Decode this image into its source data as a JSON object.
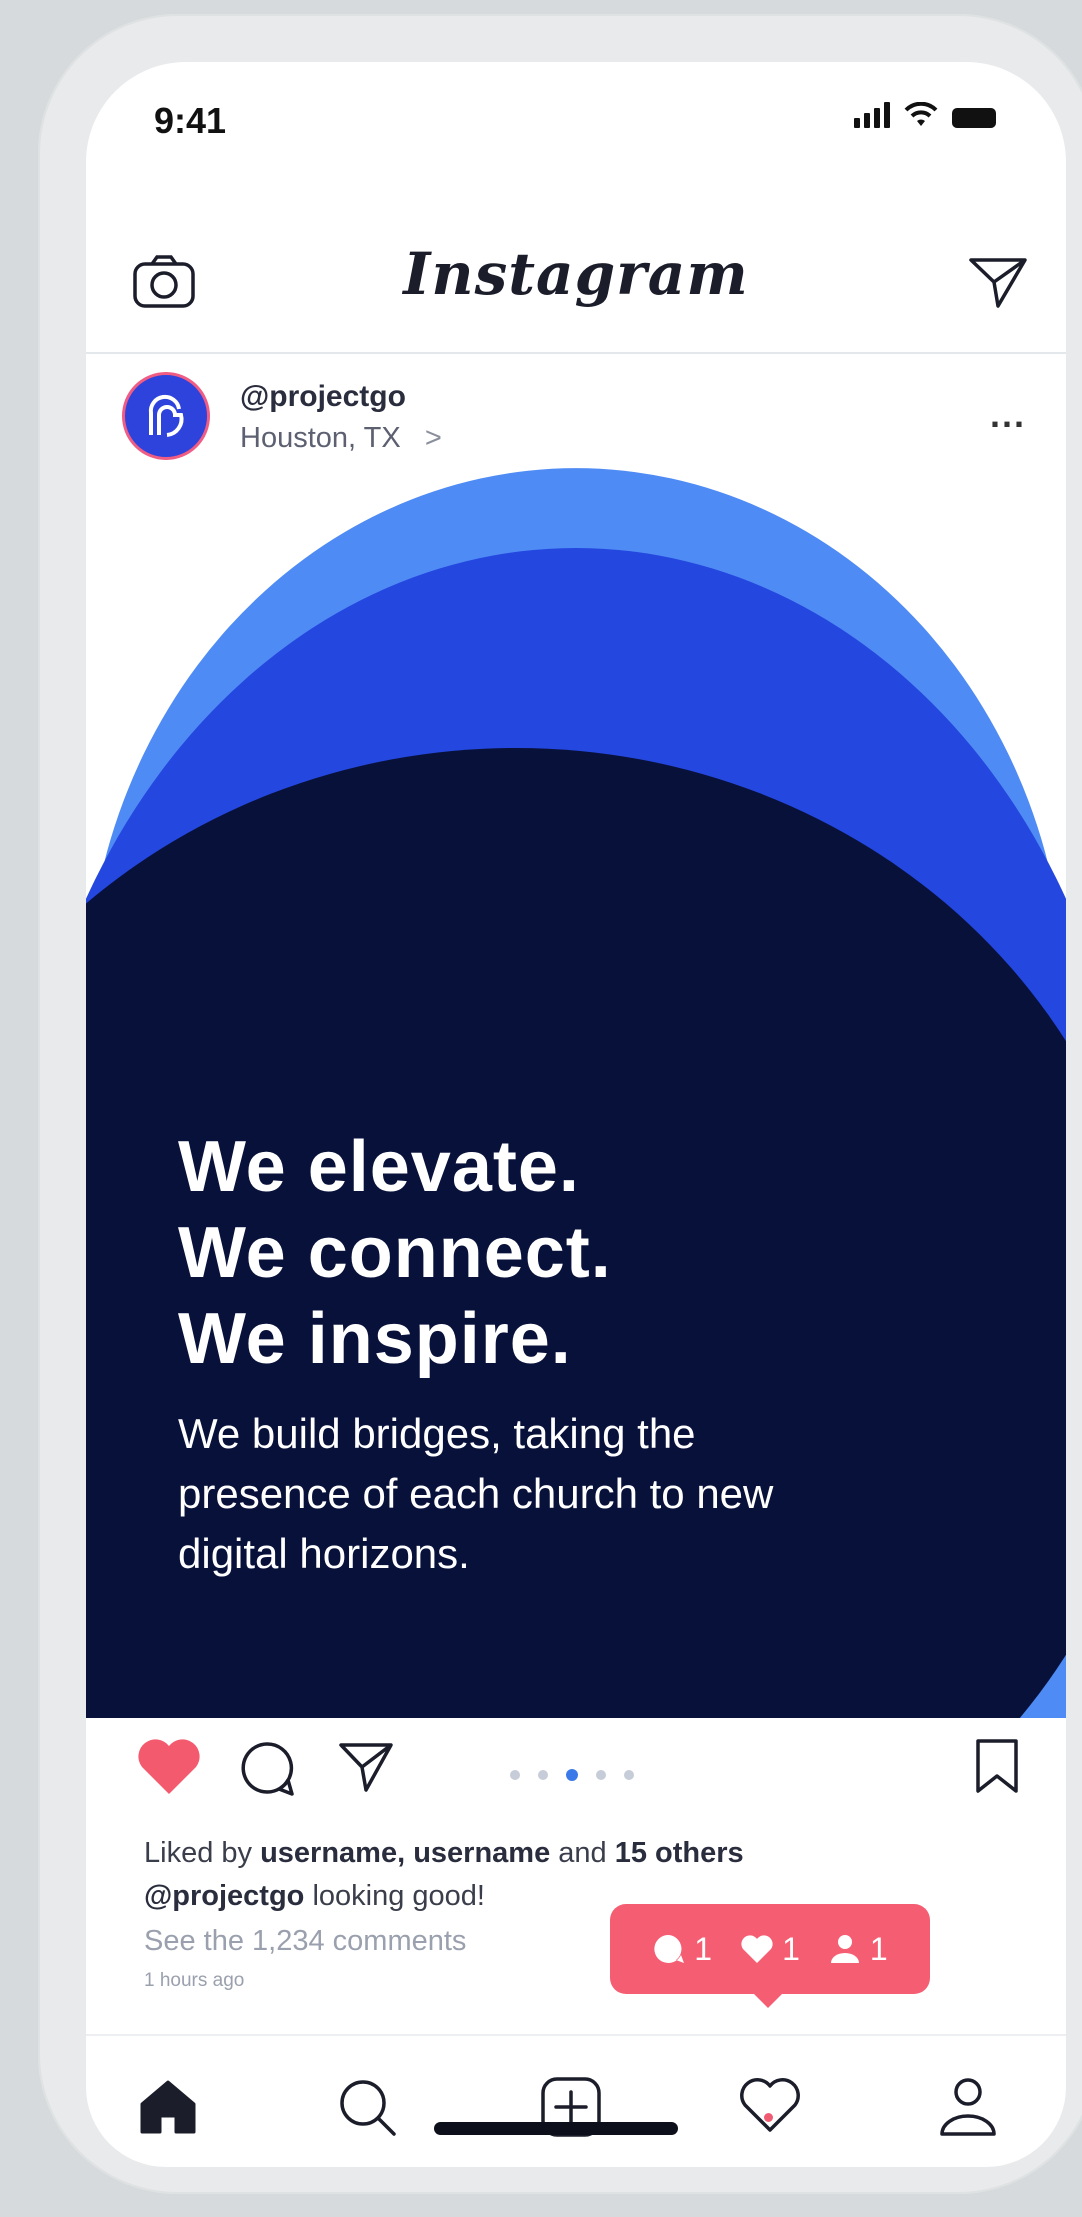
{
  "status_bar": {
    "time": "9:41"
  },
  "header": {
    "brand": "Instagram"
  },
  "post": {
    "handle": "@projectgo",
    "location": "Houston, TX",
    "location_chevron": ">",
    "more": "...",
    "headline": [
      "We elevate.",
      "We connect.",
      "We inspire."
    ],
    "subtext": "We build bridges, taking the presence of each church to new digital horizons.",
    "carousel": {
      "count": 5,
      "active_index": 2
    }
  },
  "meta": {
    "liked_by_prefix": "Liked by ",
    "liked_by_users": "username, username",
    "liked_by_and": " and ",
    "liked_by_others": "15 others",
    "caption_handle": "@projectgo",
    "caption_text": " looking good!",
    "comments_link": "See the 1,234 comments",
    "time_ago": "1 hours ago"
  },
  "notification": {
    "comments": "1",
    "likes": "1",
    "follows": "1"
  },
  "icons": {
    "camera": "camera-icon",
    "send": "send-icon",
    "heart": "heart-filled-icon",
    "comment": "comment-icon",
    "bookmark": "bookmark-icon",
    "home": "home-icon",
    "search": "search-icon",
    "add": "add-post-icon",
    "activity": "heart-outline-icon",
    "profile": "profile-icon"
  },
  "colors": {
    "like_red": "#f35a6e",
    "image_light_blue": "#4f8bf5",
    "image_mid_blue": "#2447df",
    "image_navy": "#08113a",
    "notification": "#f55e72",
    "avatar_blue": "#2d43db"
  }
}
